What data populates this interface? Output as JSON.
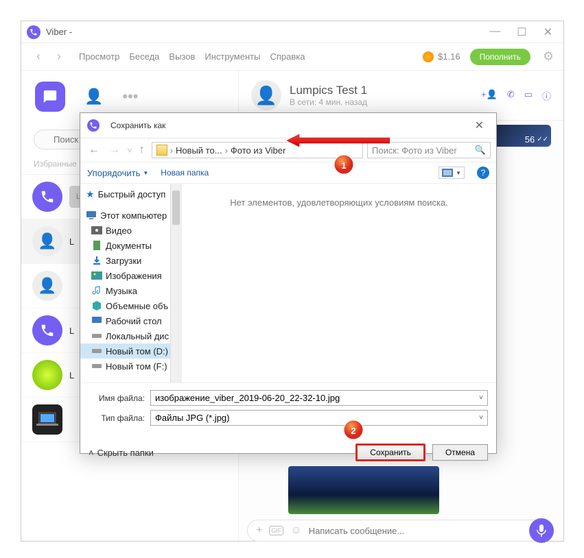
{
  "viber": {
    "title": "Viber - ",
    "menu": {
      "browse": "Просмотр",
      "chat": "Беседа",
      "call": "Вызов",
      "tools": "Инструменты",
      "help": "Справка"
    },
    "balance": "$1.16",
    "topup": "Пополнить",
    "search_placeholder": "Поиск",
    "favorites": "Избранные",
    "contacts": [
      {
        "name": ""
      },
      {
        "name": "L"
      },
      {
        "name": ""
      },
      {
        "name": "L"
      },
      {
        "name": "L"
      },
      {
        "name": ""
      }
    ],
    "chat": {
      "name": "Lumpics Test 1",
      "status": "В сети: 4 мин. назад",
      "msg_time": "56",
      "input_placeholder": "Написать сообщение..."
    }
  },
  "dialog": {
    "title": "Сохранить как",
    "breadcrumb": {
      "p1": "Новый то...",
      "p2": "Фото из Viber"
    },
    "search_placeholder": "Поиск: Фото из Viber",
    "toolbar": {
      "organize": "Упорядочить",
      "new_folder": "Новая папка"
    },
    "sidebar": {
      "quick": "Быстрый доступ",
      "thispc": "Этот компьютер",
      "items": [
        {
          "label": "Видео"
        },
        {
          "label": "Документы"
        },
        {
          "label": "Загрузки"
        },
        {
          "label": "Изображения"
        },
        {
          "label": "Музыка"
        },
        {
          "label": "Объемные объ"
        },
        {
          "label": "Рабочий стол"
        },
        {
          "label": "Локальный дис"
        },
        {
          "label": "Новый том (D:)"
        },
        {
          "label": "Новый том (F:)"
        }
      ]
    },
    "empty_msg": "Нет элементов, удовлетворяющих условиям поиска.",
    "filename_label": "Имя файла:",
    "filetype_label": "Тип файла:",
    "filename": "изображение_viber_2019-06-20_22-32-10.jpg",
    "filetype": "Файлы JPG (*.jpg)",
    "hide_folders": "Скрыть папки",
    "save": "Сохранить",
    "cancel": "Отмена"
  }
}
